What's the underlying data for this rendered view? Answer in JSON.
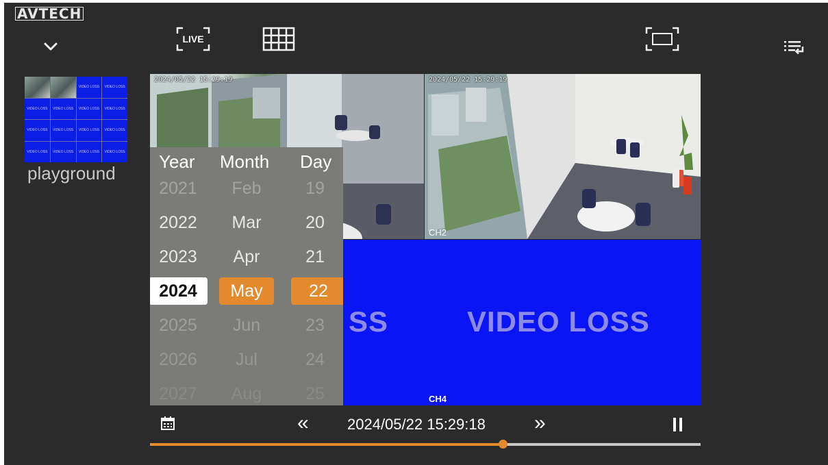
{
  "app": {
    "logo": "AVTECH"
  },
  "icons": {
    "collapse": "chevron-down-icon",
    "live": "live-view-icon",
    "layout": "grid-layout-icon",
    "fullscreen": "fullscreen-icon",
    "list": "list-menu-icon",
    "calendar": "calendar-icon",
    "rewind": "rewind-icon",
    "forward": "fast-forward-icon",
    "pause": "pause-icon"
  },
  "toolbar": {
    "live_label": "LIVE"
  },
  "device": {
    "name": "playground",
    "thumb_text": "VIDEO LOSS"
  },
  "channels": [
    {
      "timestamp": "2024/05/22 15:29:19",
      "label": ""
    },
    {
      "timestamp": "2024/05/22 15:29:19",
      "label": "CH2"
    },
    {
      "timestamp": "",
      "label": "",
      "overlay": "SS"
    },
    {
      "timestamp": "",
      "label": "CH4",
      "overlay": "VIDEO LOSS"
    }
  ],
  "date_picker": {
    "headers": {
      "year": "Year",
      "month": "Month",
      "day": "Day"
    },
    "years": [
      "2021",
      "2022",
      "2023",
      "2024",
      "2025",
      "2026",
      "2027"
    ],
    "months": [
      "Feb",
      "Mar",
      "Apr",
      "May",
      "Jun",
      "Jul",
      "Aug"
    ],
    "days": [
      "19",
      "20",
      "21",
      "22",
      "23",
      "24",
      "25"
    ],
    "selected": {
      "year": "2024",
      "month": "May",
      "day": "22"
    }
  },
  "playback": {
    "datetime": "2024/05/22 15:29:18",
    "rewind_label": "«",
    "forward_label": "»",
    "progress": 0.64
  },
  "colors": {
    "accent": "#e28a2d",
    "video_loss_blue": "#0a15f5",
    "background": "#2b2b2b"
  }
}
